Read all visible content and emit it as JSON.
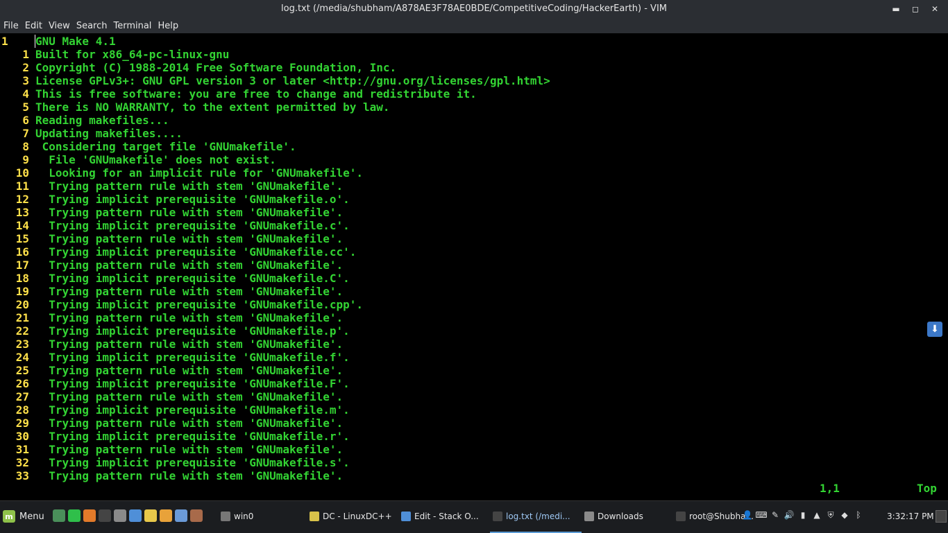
{
  "window": {
    "title": "log.txt (/media/shubham/A878AE3F78AE0BDE/CompetitiveCoding/HackerEarth) - VIM",
    "controls": {
      "minimize": "▬",
      "maximize": "◻",
      "close": "✕"
    }
  },
  "menubar": [
    "File",
    "Edit",
    "View",
    "Search",
    "Terminal",
    "Help"
  ],
  "editor": {
    "lines": [
      {
        "num": "1",
        "text": "GNU Make 4.1"
      },
      {
        "num": "1",
        "text": "Built for x86_64-pc-linux-gnu"
      },
      {
        "num": "2",
        "text": "Copyright (C) 1988-2014 Free Software Foundation, Inc."
      },
      {
        "num": "3",
        "text": "License GPLv3+: GNU GPL version 3 or later <http://gnu.org/licenses/gpl.html>"
      },
      {
        "num": "4",
        "text": "This is free software: you are free to change and redistribute it."
      },
      {
        "num": "5",
        "text": "There is NO WARRANTY, to the extent permitted by law."
      },
      {
        "num": "6",
        "text": "Reading makefiles..."
      },
      {
        "num": "7",
        "text": "Updating makefiles...."
      },
      {
        "num": "8",
        "text": " Considering target file 'GNUmakefile'."
      },
      {
        "num": "9",
        "text": "  File 'GNUmakefile' does not exist."
      },
      {
        "num": "10",
        "text": "  Looking for an implicit rule for 'GNUmakefile'."
      },
      {
        "num": "11",
        "text": "  Trying pattern rule with stem 'GNUmakefile'."
      },
      {
        "num": "12",
        "text": "  Trying implicit prerequisite 'GNUmakefile.o'."
      },
      {
        "num": "13",
        "text": "  Trying pattern rule with stem 'GNUmakefile'."
      },
      {
        "num": "14",
        "text": "  Trying implicit prerequisite 'GNUmakefile.c'."
      },
      {
        "num": "15",
        "text": "  Trying pattern rule with stem 'GNUmakefile'."
      },
      {
        "num": "16",
        "text": "  Trying implicit prerequisite 'GNUmakefile.cc'."
      },
      {
        "num": "17",
        "text": "  Trying pattern rule with stem 'GNUmakefile'."
      },
      {
        "num": "18",
        "text": "  Trying implicit prerequisite 'GNUmakefile.C'."
      },
      {
        "num": "19",
        "text": "  Trying pattern rule with stem 'GNUmakefile'."
      },
      {
        "num": "20",
        "text": "  Trying implicit prerequisite 'GNUmakefile.cpp'."
      },
      {
        "num": "21",
        "text": "  Trying pattern rule with stem 'GNUmakefile'."
      },
      {
        "num": "22",
        "text": "  Trying implicit prerequisite 'GNUmakefile.p'."
      },
      {
        "num": "23",
        "text": "  Trying pattern rule with stem 'GNUmakefile'."
      },
      {
        "num": "24",
        "text": "  Trying implicit prerequisite 'GNUmakefile.f'."
      },
      {
        "num": "25",
        "text": "  Trying pattern rule with stem 'GNUmakefile'."
      },
      {
        "num": "26",
        "text": "  Trying implicit prerequisite 'GNUmakefile.F'."
      },
      {
        "num": "27",
        "text": "  Trying pattern rule with stem 'GNUmakefile'."
      },
      {
        "num": "28",
        "text": "  Trying implicit prerequisite 'GNUmakefile.m'."
      },
      {
        "num": "29",
        "text": "  Trying pattern rule with stem 'GNUmakefile'."
      },
      {
        "num": "30",
        "text": "  Trying implicit prerequisite 'GNUmakefile.r'."
      },
      {
        "num": "31",
        "text": "  Trying pattern rule with stem 'GNUmakefile'."
      },
      {
        "num": "32",
        "text": "  Trying implicit prerequisite 'GNUmakefile.s'."
      },
      {
        "num": "33",
        "text": "  Trying pattern rule with stem 'GNUmakefile'."
      }
    ],
    "status_position": "1,1",
    "status_scroll": "Top",
    "colors": {
      "line_number": "#ffe14a",
      "text": "#33d433",
      "background": "#000000"
    }
  },
  "taskbar": {
    "menu_label": "Menu",
    "launchers": [
      {
        "icon": "terminal-icon",
        "color": "#4a8f5a"
      },
      {
        "icon": "whatsapp-icon",
        "color": "#2fbf4a"
      },
      {
        "icon": "firefox-icon",
        "color": "#e27a2a"
      },
      {
        "icon": "terminal-icon",
        "color": "#444444"
      },
      {
        "icon": "folder-icon",
        "color": "#8a8a8a"
      },
      {
        "icon": "chromium-icon",
        "color": "#4f8fd8"
      },
      {
        "icon": "notes-icon",
        "color": "#e8c84a"
      },
      {
        "icon": "vlc-icon",
        "color": "#e8a23a"
      },
      {
        "icon": "bittorrent-icon",
        "color": "#6a9ad8"
      },
      {
        "icon": "app-icon",
        "color": "#a86a4a"
      }
    ],
    "tasks": [
      {
        "label": "win0",
        "icon": "gear-icon",
        "color": "#777777",
        "active": false,
        "width": 120
      },
      {
        "label": "DC - LinuxDC++",
        "icon": "dcpp-icon",
        "color": "#d8c24a",
        "active": false,
        "width": 124
      },
      {
        "label": "Edit - Stack O...",
        "icon": "chromium-icon",
        "color": "#4f8fd8",
        "active": false,
        "width": 124
      },
      {
        "label": "log.txt (/medi...",
        "icon": "terminal-icon",
        "color": "#444444",
        "active": true,
        "width": 124
      },
      {
        "label": "Downloads",
        "icon": "folder-icon",
        "color": "#8a8a8a",
        "active": false,
        "width": 124
      },
      {
        "label": "root@Shubha...",
        "icon": "terminal-icon",
        "color": "#444444",
        "active": false,
        "width": 124
      }
    ],
    "tray": [
      "user-icon",
      "keyboard-icon",
      "pen-icon",
      "volume-icon",
      "battery-icon",
      "vlc-icon",
      "shield-icon",
      "dropbox-icon",
      "bluetooth-icon"
    ],
    "clock": "3:32:17 PM"
  }
}
